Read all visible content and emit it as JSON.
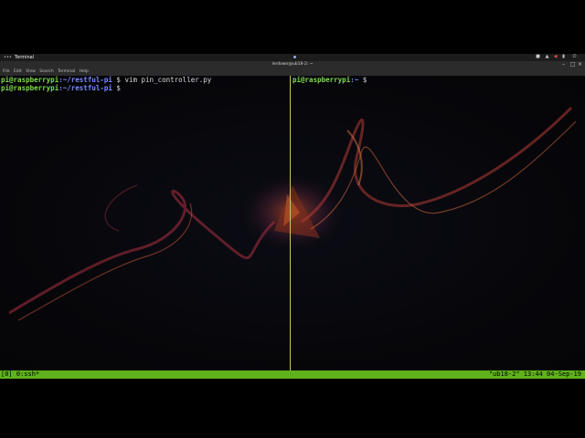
{
  "top_panel": {
    "activities": "•••",
    "app_name": "Terminal",
    "tray_icons": [
      "camera-icon",
      "network-icon",
      "volume-icon",
      "battery-icon",
      "power-icon"
    ]
  },
  "window": {
    "title": "lerdown@ub18-2: ~",
    "menu": [
      "File",
      "Edit",
      "View",
      "Search",
      "Terminal",
      "Help"
    ]
  },
  "left_pane": {
    "lines": [
      {
        "user": "pi@raspberrypi",
        "path": ":~/restful-pi",
        "rest": " $ vim pin_controller.py"
      },
      {
        "user": "pi@raspberrypi",
        "path": ":~/restful-pi",
        "rest": " $ "
      }
    ]
  },
  "right_pane": {
    "lines": [
      {
        "user": "pi@raspberrypi",
        "path": ":~",
        "rest": " $ "
      }
    ]
  },
  "tmux": {
    "left": "[0] 0:ssh*",
    "right": "\"ub18-2\" 13:44 04-Sep-19"
  },
  "colors": {
    "prompt_user": "#7cdd4a",
    "prompt_path": "#7b8cff",
    "tmux_bar": "#5fb21b",
    "pane_divider": "#c8c864"
  }
}
